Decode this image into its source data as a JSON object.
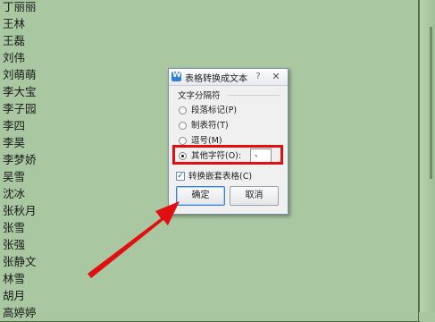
{
  "names": [
    "丁丽丽",
    "王林",
    "王磊",
    "刘伟",
    "刘萌萌",
    "李大宝",
    "李子园",
    "李四",
    "李昊",
    "李梦娇",
    "吴雪",
    "沈冰",
    "张秋月",
    "张雪",
    "张强",
    "张静文",
    "林雪",
    "胡月",
    "高婷婷"
  ],
  "dialog": {
    "title": "表格转换成文本",
    "app_icon_glyph": "W",
    "help_glyph": "?",
    "close_glyph": "✕",
    "group_label": "文字分隔符",
    "options": [
      {
        "label": "段落标记(P)",
        "selected": false
      },
      {
        "label": "制表符(T)",
        "selected": false
      },
      {
        "label": "逗号(M)",
        "selected": false
      },
      {
        "label": "其他字符(O):",
        "selected": true
      }
    ],
    "other_char_value": "、",
    "nested_table_label": "转换嵌套表格(C)",
    "nested_table_checked": true,
    "check_glyph": "✓",
    "ok_label": "确定",
    "cancel_label": "取消"
  },
  "colors": {
    "highlight": "#e01010",
    "arrow": "#e01010",
    "table_bg": "#a9c7a1"
  }
}
